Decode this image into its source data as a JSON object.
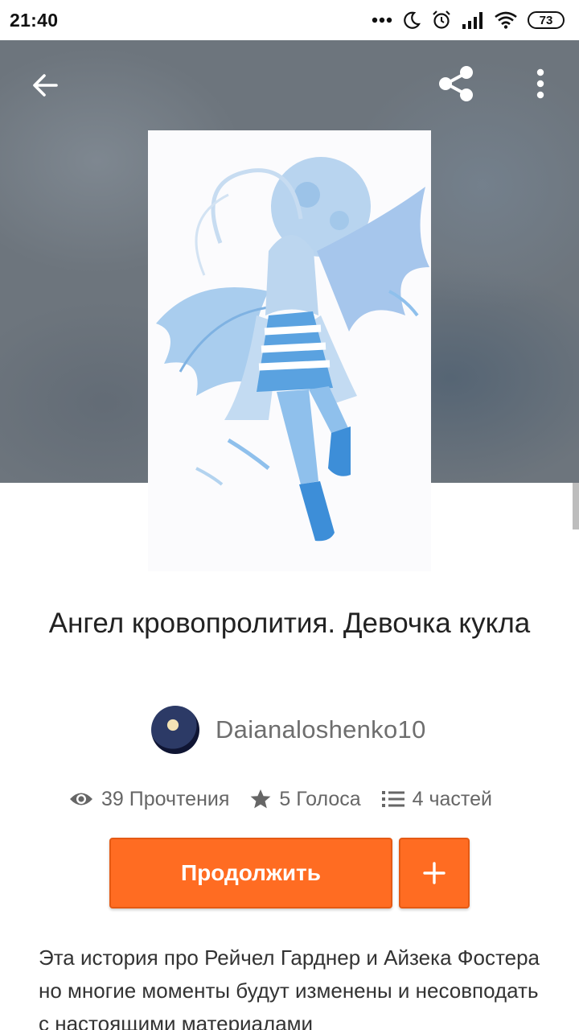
{
  "status_bar": {
    "time": "21:40",
    "battery": "73",
    "icons": [
      "more-dots-icon",
      "moon-icon",
      "alarm-icon",
      "signal-icon",
      "wifi-icon",
      "battery-icon"
    ]
  },
  "toolbar": {
    "back_icon": "arrow-left-icon",
    "share_icon": "share-icon",
    "more_icon": "more-vertical-icon"
  },
  "story": {
    "title": "Ангел кровопролития. Девочка кукла",
    "author": "Daianaloshenko10",
    "stats": {
      "reads": "39 Прочтения",
      "votes": "5 Голоса",
      "parts": "4 частей"
    },
    "continue_label": "Продолжить",
    "add_label": "+",
    "description": "Эта история про Рейчел Гарднер и Айзека Фостера но многие моменты будут изменены и несовподать с настоящими материалами"
  },
  "colors": {
    "accent": "#ff6c22",
    "hero_bg": "#6d757d"
  }
}
